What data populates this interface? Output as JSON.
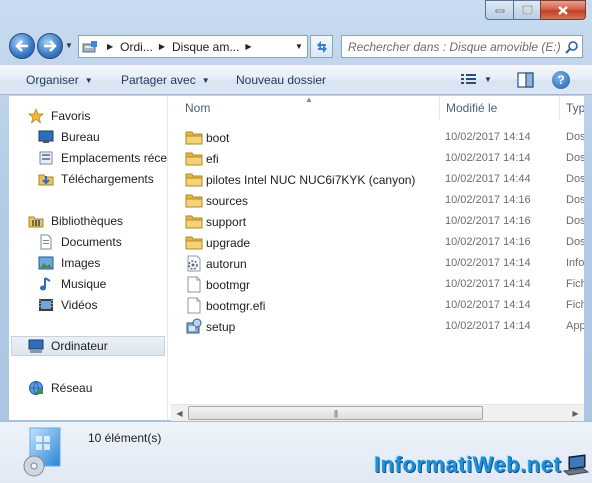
{
  "window": {
    "caption_buttons": {
      "minimize": "minimize-icon",
      "maximize": "maximize-icon",
      "close": "close-icon"
    }
  },
  "address_bar": {
    "breadcrumbs": [
      "Ordi...",
      "Disque am..."
    ]
  },
  "search": {
    "placeholder": "Rechercher dans : Disque amovible (E:)"
  },
  "toolbar": {
    "organize_label": "Organiser",
    "share_label": "Partager avec",
    "new_folder_label": "Nouveau dossier"
  },
  "navigation": {
    "favorites": {
      "label": "Favoris",
      "items": [
        {
          "label": "Bureau",
          "icon": "desktop-icon"
        },
        {
          "label": "Emplacements récen",
          "icon": "recent-places-icon"
        },
        {
          "label": "Téléchargements",
          "icon": "downloads-icon"
        }
      ]
    },
    "libraries": {
      "label": "Bibliothèques",
      "items": [
        {
          "label": "Documents",
          "icon": "documents-icon"
        },
        {
          "label": "Images",
          "icon": "images-icon"
        },
        {
          "label": "Musique",
          "icon": "music-icon"
        },
        {
          "label": "Vidéos",
          "icon": "videos-icon"
        }
      ]
    },
    "computer": {
      "label": "Ordinateur"
    },
    "network": {
      "label": "Réseau"
    }
  },
  "file_list": {
    "columns": [
      "Nom",
      "Modifié le",
      "Typ"
    ],
    "rows": [
      {
        "name": "boot",
        "modified": "10/02/2017 14:14",
        "type": "Dos",
        "icon": "folder-icon"
      },
      {
        "name": "efi",
        "modified": "10/02/2017 14:14",
        "type": "Dos",
        "icon": "folder-icon"
      },
      {
        "name": "pilotes Intel NUC NUC6i7KYK (canyon)",
        "modified": "10/02/2017 14:44",
        "type": "Dos",
        "icon": "folder-icon"
      },
      {
        "name": "sources",
        "modified": "10/02/2017 14:16",
        "type": "Dos",
        "icon": "folder-icon"
      },
      {
        "name": "support",
        "modified": "10/02/2017 14:16",
        "type": "Dos",
        "icon": "folder-icon"
      },
      {
        "name": "upgrade",
        "modified": "10/02/2017 14:16",
        "type": "Dos",
        "icon": "folder-icon"
      },
      {
        "name": "autorun",
        "modified": "10/02/2017 14:14",
        "type": "Info",
        "icon": "settings-file-icon"
      },
      {
        "name": "bootmgr",
        "modified": "10/02/2017 14:14",
        "type": "Fich",
        "icon": "file-icon"
      },
      {
        "name": "bootmgr.efi",
        "modified": "10/02/2017 14:14",
        "type": "Fich",
        "icon": "file-icon"
      },
      {
        "name": "setup",
        "modified": "10/02/2017 14:14",
        "type": "App",
        "icon": "setup-app-icon"
      }
    ]
  },
  "details_pane": {
    "item_count": "10 élément(s)"
  },
  "watermark": {
    "text": "InformatiWeb.net"
  },
  "colors": {
    "frame": "#b3cbe6",
    "toolbar_text": "#1e395b",
    "secondary_text": "#6d6d6d",
    "watermark": "#1e8fd8"
  }
}
